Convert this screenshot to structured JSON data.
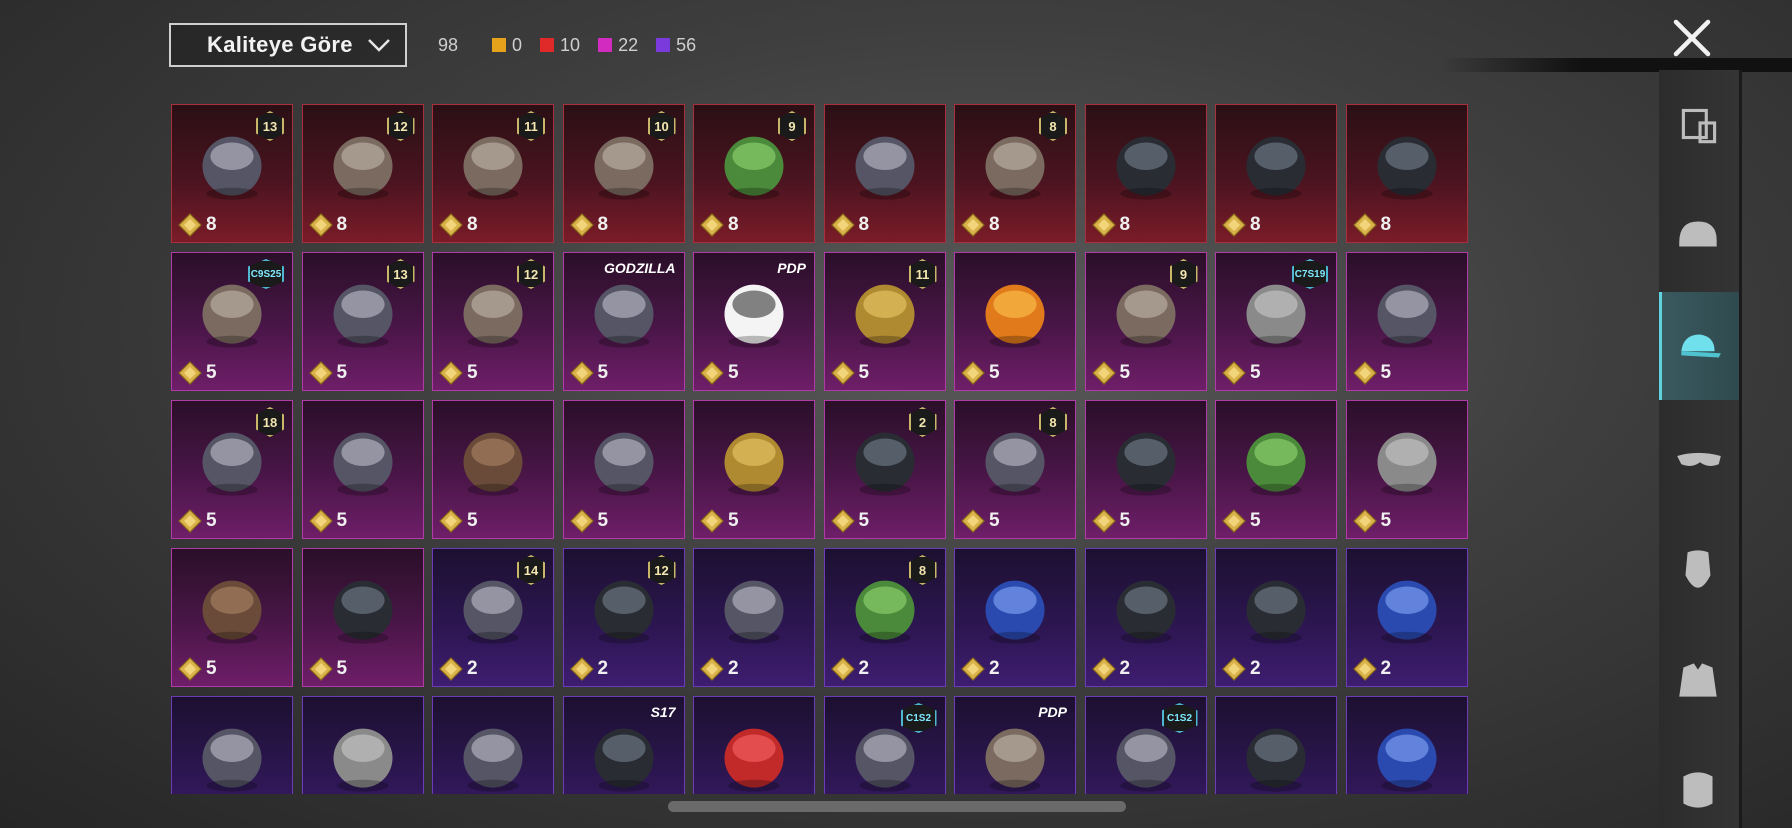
{
  "sort": {
    "label": "Kaliteye Göre"
  },
  "counts": {
    "total": "98",
    "items": [
      {
        "color": "#e5a21a",
        "value": "0"
      },
      {
        "color": "#e02a2a",
        "value": "10"
      },
      {
        "color": "#d12bbf",
        "value": "22"
      },
      {
        "color": "#7b3bdc",
        "value": "56"
      }
    ]
  },
  "grid": {
    "rows": [
      [
        {
          "rarity": "red",
          "badge": "13",
          "value": "8",
          "icon": "cowboy-hat-icon"
        },
        {
          "rarity": "red",
          "badge": "12",
          "value": "8",
          "icon": "white-hair-icon"
        },
        {
          "rarity": "red",
          "badge": "11",
          "value": "8",
          "icon": "black-hair-icon"
        },
        {
          "rarity": "red",
          "badge": "10",
          "value": "8",
          "icon": "dreadlock-hair-icon"
        },
        {
          "rarity": "red",
          "badge": "9",
          "value": "8",
          "icon": "zombie-head-icon"
        },
        {
          "rarity": "red",
          "badge": "",
          "value": "8",
          "icon": "white-cowboy-hat-icon"
        },
        {
          "rarity": "red",
          "badge": "8",
          "value": "8",
          "icon": "blond-hair-icon"
        },
        {
          "rarity": "red",
          "badge": "",
          "value": "8",
          "icon": "dragon-helmet-icon"
        },
        {
          "rarity": "red",
          "badge": "",
          "value": "8",
          "icon": "oni-mask-icon"
        },
        {
          "rarity": "red",
          "badge": "",
          "value": "8",
          "icon": "dark-helmet-icon"
        }
      ],
      [
        {
          "rarity": "pink",
          "badge": "C9S25",
          "badgeType": "tag",
          "value": "5",
          "icon": "silver-hair-icon"
        },
        {
          "rarity": "pink",
          "badge": "13",
          "value": "5",
          "icon": "goggles-cap-icon"
        },
        {
          "rarity": "pink",
          "badge": "12",
          "value": "5",
          "icon": "orange-hair-icon"
        },
        {
          "rarity": "pink",
          "badge": "GODZILLA",
          "badgeType": "text",
          "value": "5",
          "icon": "spiked-cap-icon"
        },
        {
          "rarity": "pink",
          "badge": "PDP",
          "badgeType": "text",
          "value": "5",
          "icon": "panda-head-icon"
        },
        {
          "rarity": "pink",
          "badge": "11",
          "value": "5",
          "icon": "flower-crown-icon"
        },
        {
          "rarity": "pink",
          "badge": "",
          "value": "5",
          "icon": "pumpkin-head-icon"
        },
        {
          "rarity": "pink",
          "badge": "9",
          "value": "5",
          "icon": "long-hair-icon"
        },
        {
          "rarity": "pink",
          "badge": "C7S19",
          "badgeType": "tag",
          "value": "5",
          "icon": "feather-headdress-icon"
        },
        {
          "rarity": "pink",
          "badge": "",
          "value": "5",
          "icon": "feather-hat-icon"
        }
      ],
      [
        {
          "rarity": "pink",
          "badge": "18",
          "value": "5",
          "icon": "uncle-sam-hat-icon"
        },
        {
          "rarity": "pink",
          "badge": "",
          "value": "5",
          "icon": "bucket-hat-icon"
        },
        {
          "rarity": "pink",
          "badge": "",
          "value": "5",
          "icon": "rat-head-icon"
        },
        {
          "rarity": "pink",
          "badge": "",
          "value": "5",
          "icon": "straw-hat-icon"
        },
        {
          "rarity": "pink",
          "badge": "",
          "value": "5",
          "icon": "golden-crown-icon"
        },
        {
          "rarity": "pink",
          "badge": "2",
          "value": "5",
          "icon": "knight-mask-icon"
        },
        {
          "rarity": "pink",
          "badge": "8",
          "value": "5",
          "icon": "robot-hat-icon"
        },
        {
          "rarity": "pink",
          "badge": "",
          "value": "5",
          "icon": "spiked-mask-icon"
        },
        {
          "rarity": "pink",
          "badge": "",
          "value": "5",
          "icon": "frog-helmet-icon"
        },
        {
          "rarity": "pink",
          "badge": "",
          "value": "5",
          "icon": "headband-icon"
        }
      ],
      [
        {
          "rarity": "pink",
          "badge": "",
          "value": "5",
          "icon": "bear-head-icon"
        },
        {
          "rarity": "pink",
          "badge": "",
          "value": "5",
          "icon": "skull-balaclava-icon"
        },
        {
          "rarity": "purple",
          "badge": "14",
          "value": "2",
          "icon": "cat-cap-icon"
        },
        {
          "rarity": "purple",
          "badge": "12",
          "value": "2",
          "icon": "bunny-helmet-icon"
        },
        {
          "rarity": "purple",
          "badge": "",
          "value": "2",
          "icon": "officer-cap-icon"
        },
        {
          "rarity": "purple",
          "badge": "8",
          "value": "2",
          "icon": "green-skull-icon"
        },
        {
          "rarity": "purple",
          "badge": "",
          "value": "2",
          "icon": "baseball-cap-icon"
        },
        {
          "rarity": "purple",
          "badge": "",
          "value": "2",
          "icon": "gas-mask-helmet-icon"
        },
        {
          "rarity": "purple",
          "badge": "",
          "value": "2",
          "icon": "visor-helmet-icon"
        },
        {
          "rarity": "purple",
          "badge": "",
          "value": "2",
          "icon": "blue-hair-icon"
        }
      ],
      [
        {
          "rarity": "purple",
          "badge": "",
          "value": "",
          "icon": "flat-cap-icon"
        },
        {
          "rarity": "purple",
          "badge": "",
          "value": "",
          "icon": "devil-horns-icon"
        },
        {
          "rarity": "purple",
          "badge": "",
          "value": "",
          "icon": "beanie-icon"
        },
        {
          "rarity": "purple",
          "badge": "S17",
          "badgeType": "text",
          "value": "",
          "icon": "horned-helmet-icon"
        },
        {
          "rarity": "purple",
          "badge": "",
          "value": "",
          "icon": "fez-hat-icon"
        },
        {
          "rarity": "purple",
          "badge": "C1S2",
          "badgeType": "tag",
          "value": "",
          "icon": "striped-beanie-icon"
        },
        {
          "rarity": "purple",
          "badge": "PDP",
          "badgeType": "text",
          "value": "",
          "icon": "gray-hair-icon"
        },
        {
          "rarity": "purple",
          "badge": "C1S2",
          "badgeType": "tag",
          "value": "",
          "icon": "chef-hat-icon"
        },
        {
          "rarity": "purple",
          "badge": "",
          "value": "",
          "icon": "football-helmet-icon"
        },
        {
          "rarity": "purple",
          "badge": "",
          "value": "",
          "icon": "cricket-helmet-icon"
        }
      ]
    ]
  },
  "sidebar": {
    "tabs": [
      {
        "name": "outfit-tab",
        "icon": "outfit-icon"
      },
      {
        "name": "helmet-tab",
        "icon": "helmet-icon"
      },
      {
        "name": "hat-tab",
        "icon": "cap-icon",
        "active": true
      },
      {
        "name": "glasses-tab",
        "icon": "glasses-icon"
      },
      {
        "name": "face-tab",
        "icon": "face-icon"
      },
      {
        "name": "jacket-tab",
        "icon": "jacket-icon"
      },
      {
        "name": "mask-tab",
        "icon": "mask-icon"
      }
    ]
  }
}
